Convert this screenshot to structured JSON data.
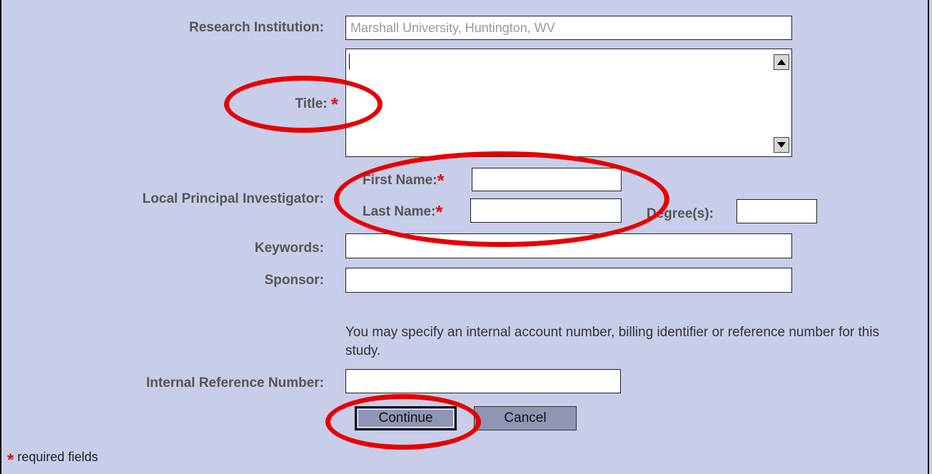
{
  "form": {
    "research_institution_label": "Research Institution:",
    "research_institution_value": "Marshall University, Huntington, WV",
    "title_label": "Title:",
    "required_mark": "*",
    "lpi_label": "Local Principal Investigator:",
    "first_name_label": "First Name:",
    "last_name_label": "Last Name:",
    "degrees_label": "Degree(s):",
    "keywords_label": "Keywords:",
    "sponsor_label": "Sponsor:",
    "internal_ref_help": "You may specify an internal account number, billing identifier or reference number for this study.",
    "internal_ref_label": "Internal Reference Number:",
    "continue_label": "Continue",
    "cancel_label": "Cancel",
    "required_note": "required fields"
  },
  "icons": [
    "scroll-up-arrow-icon",
    "scroll-down-arrow-icon"
  ],
  "colors": {
    "background": "#c8cde9",
    "button": "#8f96b5",
    "annotation_ring": "#e60000",
    "required_star": "#e01010"
  }
}
